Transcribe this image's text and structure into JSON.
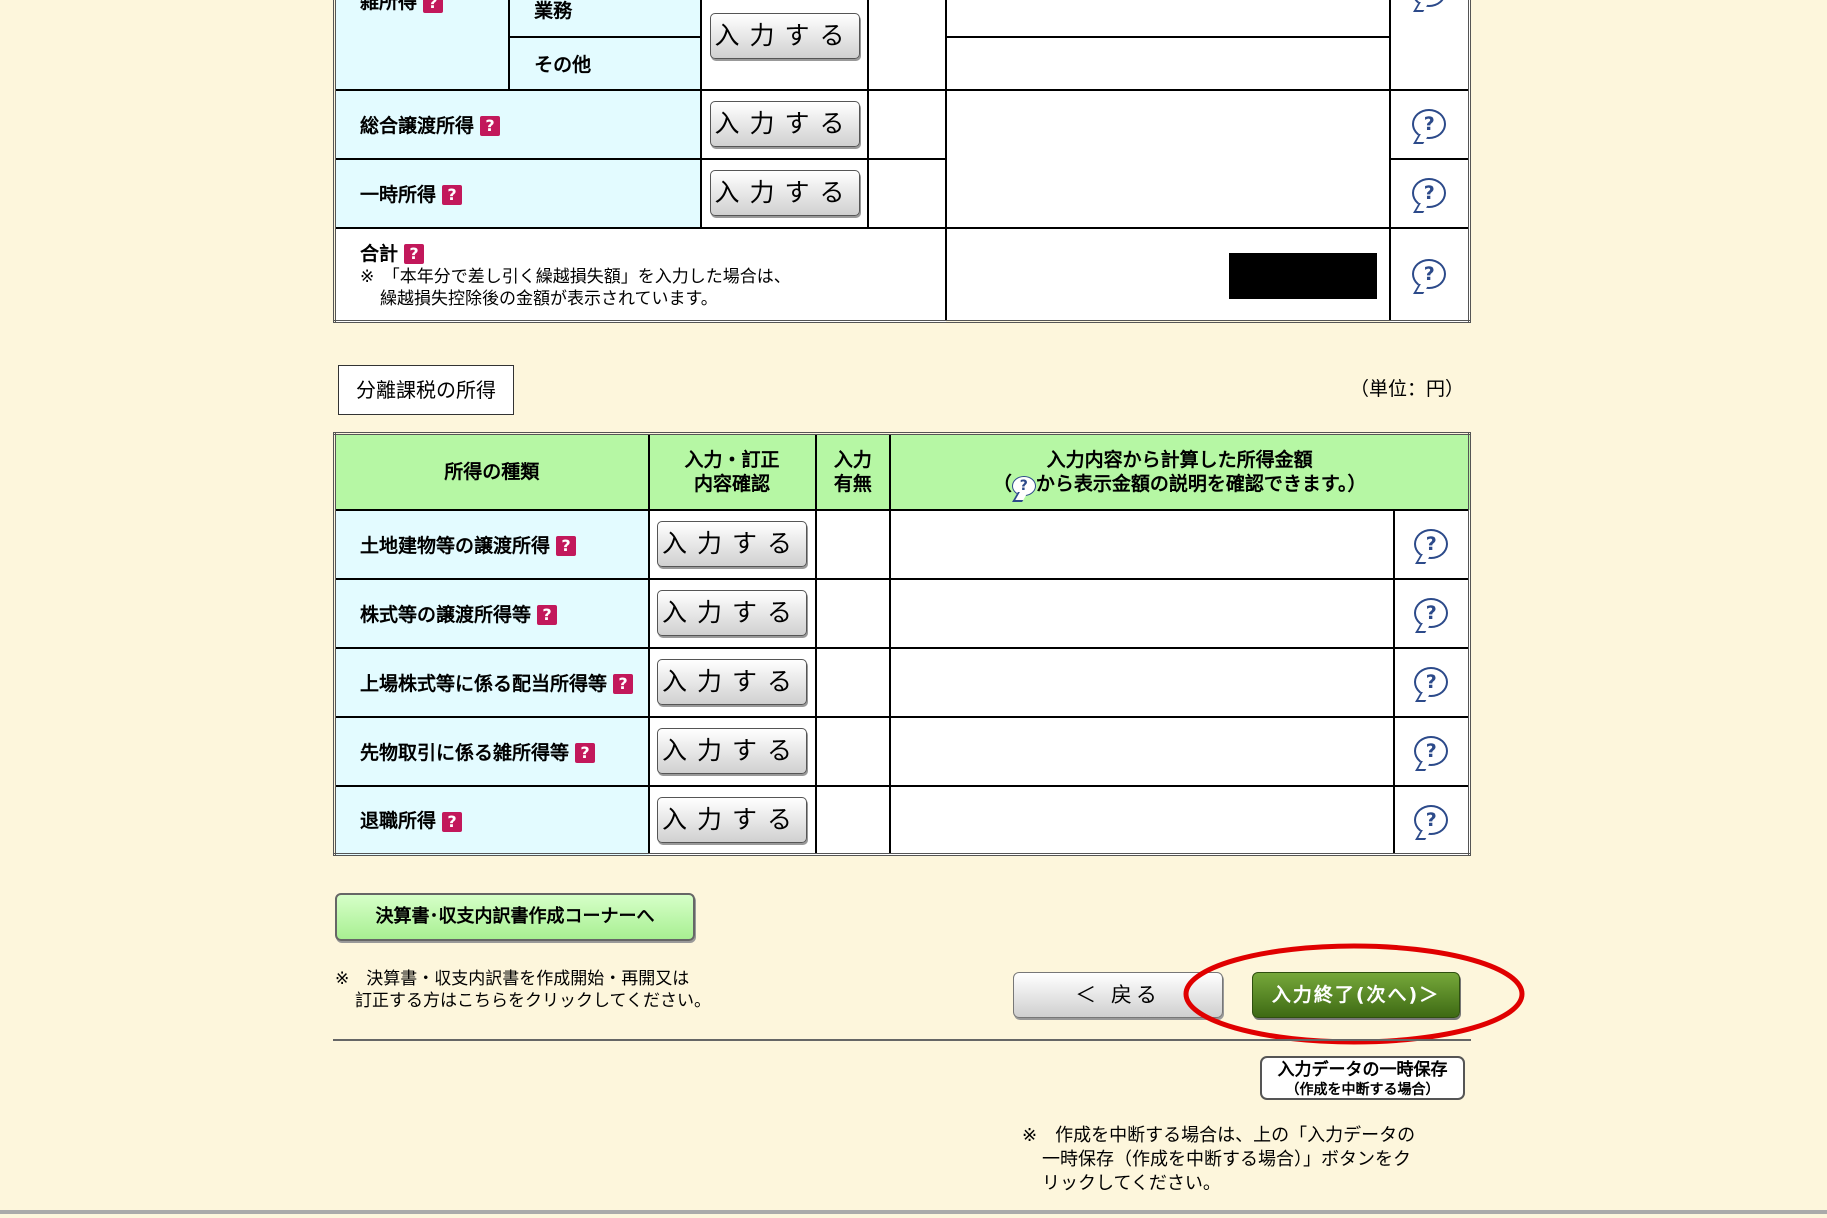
{
  "top_table": {
    "label_partial": "雑所得",
    "sub_gyomu": "業務",
    "sub_sonota": "その他",
    "rows": [
      {
        "label": "総合譲渡所得"
      },
      {
        "label": "一時所得"
      }
    ],
    "total_label": "合計",
    "total_note_1": "※　「本年分で差し引く繰越損失額」を入力した場合は、",
    "total_note_2": "繰越損失控除後の金額が表示されています。"
  },
  "input_button_label": "入力する",
  "help_bubble": "?",
  "help_square": "?",
  "separate_section": {
    "title": "分離課税の所得",
    "unit": "（単位：円）",
    "headers": {
      "kind": "所得の種類",
      "confirm_1": "入力・訂正",
      "confirm_2": "内容確認",
      "has_1": "入力",
      "has_2": "有無",
      "amount_1": "入力内容から計算した所得金額",
      "amount_2_pre": "（",
      "amount_2_post": "から表示金額の説明を確認できます。）"
    },
    "rows": [
      {
        "label": "土地建物等の譲渡所得"
      },
      {
        "label": "株式等の譲渡所得等"
      },
      {
        "label": "上場株式等に係る配当所得等"
      },
      {
        "label": "先物取引に係る雑所得等"
      },
      {
        "label": "退職所得"
      }
    ]
  },
  "kessansho_button": "決算書･収支内訳書作成コーナーへ",
  "kessansho_note_1": "※　決算書・収支内訳書を作成開始・再開又は",
  "kessansho_note_2": "訂正する方はこちらをクリックしてください。",
  "back_button": "＜ 戻る",
  "next_button": "入力終了(次へ)＞",
  "save_button_1": "入力データの一時保存",
  "save_button_2": "（作成を中断する場合）",
  "save_note_1": "※　作成を中断する場合は、上の「入力データの",
  "save_note_2": "一時保存（作成を中断する場合）」ボタンをク",
  "save_note_3": "リックしてください。",
  "colors": {
    "background": "#fdf6dc",
    "label_cell": "#e3fbff",
    "header_cell": "#b6f7a4",
    "next_button": "#4e7a1e",
    "highlight_ellipse": "#e00000"
  }
}
